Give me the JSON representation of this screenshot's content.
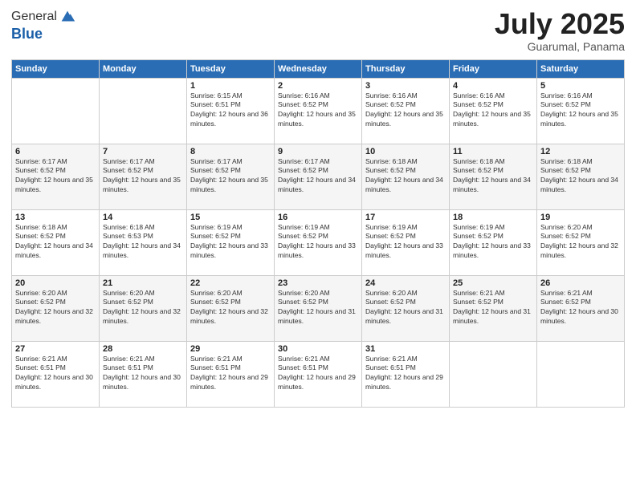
{
  "logo": {
    "general": "General",
    "blue": "Blue"
  },
  "title": {
    "month": "July 2025",
    "location": "Guarumal, Panama"
  },
  "days_of_week": [
    "Sunday",
    "Monday",
    "Tuesday",
    "Wednesday",
    "Thursday",
    "Friday",
    "Saturday"
  ],
  "weeks": [
    [
      {
        "day": "",
        "sunrise": "",
        "sunset": "",
        "daylight": ""
      },
      {
        "day": "",
        "sunrise": "",
        "sunset": "",
        "daylight": ""
      },
      {
        "day": "1",
        "sunrise": "Sunrise: 6:15 AM",
        "sunset": "Sunset: 6:51 PM",
        "daylight": "Daylight: 12 hours and 36 minutes."
      },
      {
        "day": "2",
        "sunrise": "Sunrise: 6:16 AM",
        "sunset": "Sunset: 6:52 PM",
        "daylight": "Daylight: 12 hours and 35 minutes."
      },
      {
        "day": "3",
        "sunrise": "Sunrise: 6:16 AM",
        "sunset": "Sunset: 6:52 PM",
        "daylight": "Daylight: 12 hours and 35 minutes."
      },
      {
        "day": "4",
        "sunrise": "Sunrise: 6:16 AM",
        "sunset": "Sunset: 6:52 PM",
        "daylight": "Daylight: 12 hours and 35 minutes."
      },
      {
        "day": "5",
        "sunrise": "Sunrise: 6:16 AM",
        "sunset": "Sunset: 6:52 PM",
        "daylight": "Daylight: 12 hours and 35 minutes."
      }
    ],
    [
      {
        "day": "6",
        "sunrise": "Sunrise: 6:17 AM",
        "sunset": "Sunset: 6:52 PM",
        "daylight": "Daylight: 12 hours and 35 minutes."
      },
      {
        "day": "7",
        "sunrise": "Sunrise: 6:17 AM",
        "sunset": "Sunset: 6:52 PM",
        "daylight": "Daylight: 12 hours and 35 minutes."
      },
      {
        "day": "8",
        "sunrise": "Sunrise: 6:17 AM",
        "sunset": "Sunset: 6:52 PM",
        "daylight": "Daylight: 12 hours and 35 minutes."
      },
      {
        "day": "9",
        "sunrise": "Sunrise: 6:17 AM",
        "sunset": "Sunset: 6:52 PM",
        "daylight": "Daylight: 12 hours and 34 minutes."
      },
      {
        "day": "10",
        "sunrise": "Sunrise: 6:18 AM",
        "sunset": "Sunset: 6:52 PM",
        "daylight": "Daylight: 12 hours and 34 minutes."
      },
      {
        "day": "11",
        "sunrise": "Sunrise: 6:18 AM",
        "sunset": "Sunset: 6:52 PM",
        "daylight": "Daylight: 12 hours and 34 minutes."
      },
      {
        "day": "12",
        "sunrise": "Sunrise: 6:18 AM",
        "sunset": "Sunset: 6:52 PM",
        "daylight": "Daylight: 12 hours and 34 minutes."
      }
    ],
    [
      {
        "day": "13",
        "sunrise": "Sunrise: 6:18 AM",
        "sunset": "Sunset: 6:52 PM",
        "daylight": "Daylight: 12 hours and 34 minutes."
      },
      {
        "day": "14",
        "sunrise": "Sunrise: 6:18 AM",
        "sunset": "Sunset: 6:53 PM",
        "daylight": "Daylight: 12 hours and 34 minutes."
      },
      {
        "day": "15",
        "sunrise": "Sunrise: 6:19 AM",
        "sunset": "Sunset: 6:52 PM",
        "daylight": "Daylight: 12 hours and 33 minutes."
      },
      {
        "day": "16",
        "sunrise": "Sunrise: 6:19 AM",
        "sunset": "Sunset: 6:52 PM",
        "daylight": "Daylight: 12 hours and 33 minutes."
      },
      {
        "day": "17",
        "sunrise": "Sunrise: 6:19 AM",
        "sunset": "Sunset: 6:52 PM",
        "daylight": "Daylight: 12 hours and 33 minutes."
      },
      {
        "day": "18",
        "sunrise": "Sunrise: 6:19 AM",
        "sunset": "Sunset: 6:52 PM",
        "daylight": "Daylight: 12 hours and 33 minutes."
      },
      {
        "day": "19",
        "sunrise": "Sunrise: 6:20 AM",
        "sunset": "Sunset: 6:52 PM",
        "daylight": "Daylight: 12 hours and 32 minutes."
      }
    ],
    [
      {
        "day": "20",
        "sunrise": "Sunrise: 6:20 AM",
        "sunset": "Sunset: 6:52 PM",
        "daylight": "Daylight: 12 hours and 32 minutes."
      },
      {
        "day": "21",
        "sunrise": "Sunrise: 6:20 AM",
        "sunset": "Sunset: 6:52 PM",
        "daylight": "Daylight: 12 hours and 32 minutes."
      },
      {
        "day": "22",
        "sunrise": "Sunrise: 6:20 AM",
        "sunset": "Sunset: 6:52 PM",
        "daylight": "Daylight: 12 hours and 32 minutes."
      },
      {
        "day": "23",
        "sunrise": "Sunrise: 6:20 AM",
        "sunset": "Sunset: 6:52 PM",
        "daylight": "Daylight: 12 hours and 31 minutes."
      },
      {
        "day": "24",
        "sunrise": "Sunrise: 6:20 AM",
        "sunset": "Sunset: 6:52 PM",
        "daylight": "Daylight: 12 hours and 31 minutes."
      },
      {
        "day": "25",
        "sunrise": "Sunrise: 6:21 AM",
        "sunset": "Sunset: 6:52 PM",
        "daylight": "Daylight: 12 hours and 31 minutes."
      },
      {
        "day": "26",
        "sunrise": "Sunrise: 6:21 AM",
        "sunset": "Sunset: 6:52 PM",
        "daylight": "Daylight: 12 hours and 30 minutes."
      }
    ],
    [
      {
        "day": "27",
        "sunrise": "Sunrise: 6:21 AM",
        "sunset": "Sunset: 6:51 PM",
        "daylight": "Daylight: 12 hours and 30 minutes."
      },
      {
        "day": "28",
        "sunrise": "Sunrise: 6:21 AM",
        "sunset": "Sunset: 6:51 PM",
        "daylight": "Daylight: 12 hours and 30 minutes."
      },
      {
        "day": "29",
        "sunrise": "Sunrise: 6:21 AM",
        "sunset": "Sunset: 6:51 PM",
        "daylight": "Daylight: 12 hours and 29 minutes."
      },
      {
        "day": "30",
        "sunrise": "Sunrise: 6:21 AM",
        "sunset": "Sunset: 6:51 PM",
        "daylight": "Daylight: 12 hours and 29 minutes."
      },
      {
        "day": "31",
        "sunrise": "Sunrise: 6:21 AM",
        "sunset": "Sunset: 6:51 PM",
        "daylight": "Daylight: 12 hours and 29 minutes."
      },
      {
        "day": "",
        "sunrise": "",
        "sunset": "",
        "daylight": ""
      },
      {
        "day": "",
        "sunrise": "",
        "sunset": "",
        "daylight": ""
      }
    ]
  ]
}
